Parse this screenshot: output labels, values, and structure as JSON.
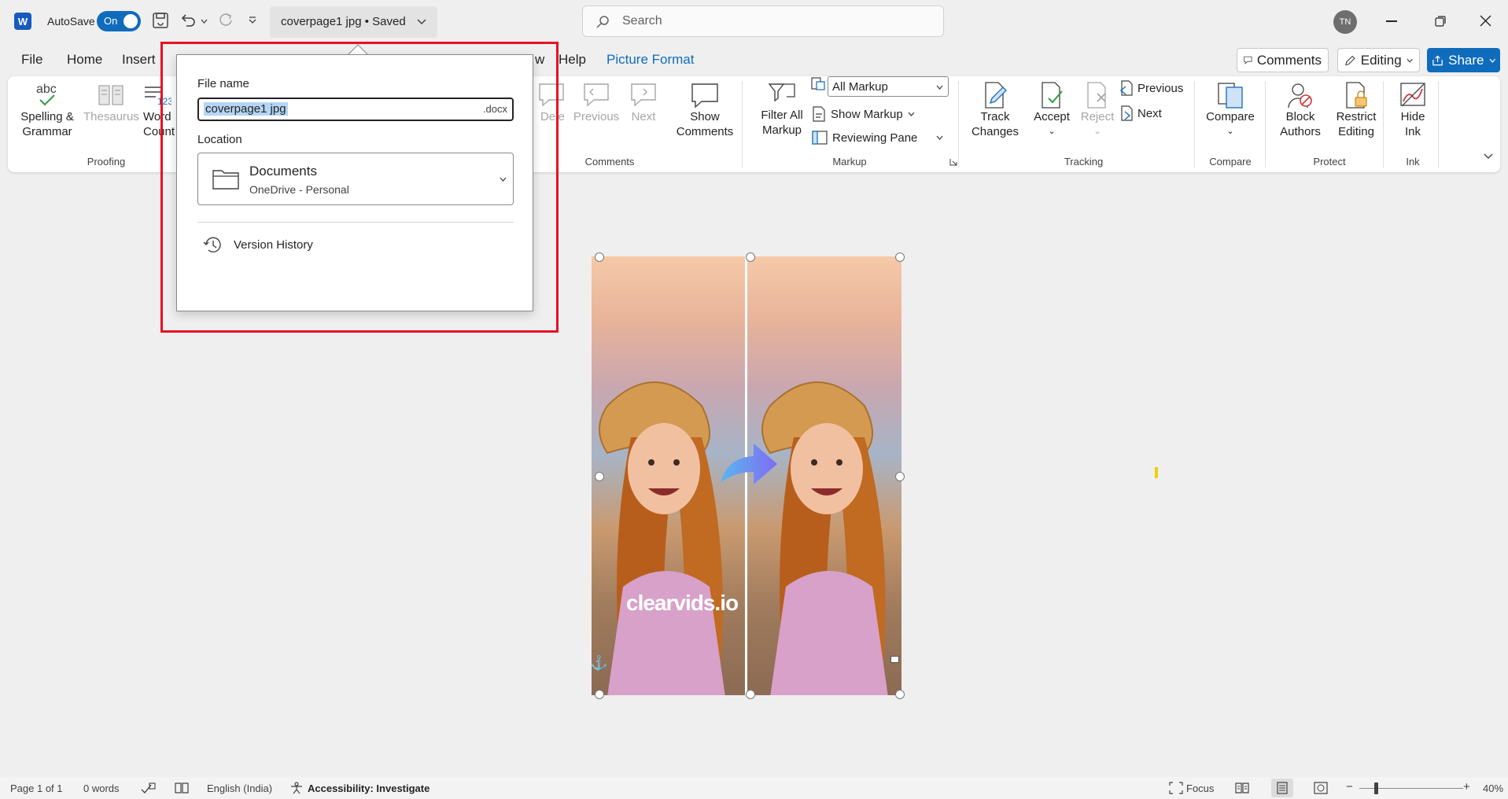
{
  "titlebar": {
    "autosave_label": "AutoSave",
    "autosave_state": "On",
    "file_title": "coverpage1 jpg • Saved",
    "search_placeholder": "Search",
    "user_initials": "TN"
  },
  "menu": {
    "tabs": [
      "File",
      "Home",
      "Insert",
      "w",
      "Help",
      "Picture Format"
    ],
    "comments_button": "Comments",
    "editing_button": "Editing",
    "share_button": "Share"
  },
  "ribbon": {
    "proofing": {
      "spelling": [
        "Spelling &",
        "Grammar"
      ],
      "thesaurus": "Thesaurus",
      "word_count": [
        "Word",
        "Count"
      ],
      "group_label": "Proofing"
    },
    "comments": {
      "delete": "Delete",
      "previous": "Previous",
      "next": "Next",
      "show_comments": [
        "Show",
        "Comments"
      ],
      "group_label": "Comments"
    },
    "markup": {
      "filter_all": [
        "Filter All",
        "Markup"
      ],
      "markup_select": "All Markup",
      "show_markup": "Show Markup",
      "reviewing_pane": "Reviewing Pane",
      "group_label": "Markup"
    },
    "tracking": {
      "track_changes": [
        "Track",
        "Changes"
      ],
      "accept": "Accept",
      "reject": "Reject",
      "previous": "Previous",
      "next": "Next",
      "group_label": "Tracking"
    },
    "compare": {
      "compare": "Compare",
      "group_label": "Compare"
    },
    "protect": {
      "block_authors": [
        "Block",
        "Authors"
      ],
      "restrict_editing": [
        "Restrict",
        "Editing"
      ],
      "group_label": "Protect"
    },
    "ink": {
      "hide_ink": [
        "Hide",
        "Ink"
      ],
      "group_label": "Ink"
    }
  },
  "save_popup": {
    "file_name_label": "File name",
    "file_name_value": "coverpage1 jpg",
    "extension": ".docx",
    "location_label": "Location",
    "location_name": "Documents",
    "location_sub": "OneDrive - Personal",
    "version_history": "Version History"
  },
  "document": {
    "watermark": "clearvids.io"
  },
  "statusbar": {
    "page": "Page 1 of 1",
    "words": "0 words",
    "language": "English (India)",
    "accessibility": "Accessibility: Investigate",
    "focus": "Focus",
    "zoom": "40%"
  },
  "colors": {
    "accent": "#0f6cbd",
    "highlight_frame": "#e81123",
    "selection": "#b4d5f4"
  }
}
